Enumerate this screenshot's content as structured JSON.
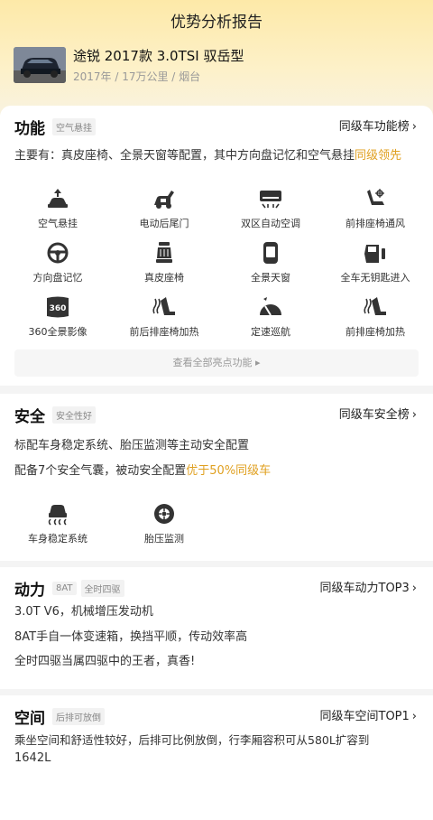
{
  "header": {
    "title": "优势分析报告",
    "car_name": "途锐 2017款 3.0TSI 驭岳型",
    "car_meta": "2017年 / 17万公里 / 烟台"
  },
  "function": {
    "title": "功能",
    "tag": "空气悬挂",
    "rank": "同级车功能榜",
    "desc_main": "主要有：真皮座椅、全景天窗等配置，其中方向盘记忆和空气悬挂",
    "desc_hl": "同级领先",
    "features": [
      {
        "label": "空气悬挂",
        "icon": "air-suspension-icon"
      },
      {
        "label": "电动后尾门",
        "icon": "power-tailgate-icon"
      },
      {
        "label": "双区自动空调",
        "icon": "dual-zone-ac-icon"
      },
      {
        "label": "前排座椅通风",
        "icon": "seat-ventilation-icon"
      },
      {
        "label": "方向盘记忆",
        "icon": "steering-wheel-icon"
      },
      {
        "label": "真皮座椅",
        "icon": "leather-seat-icon"
      },
      {
        "label": "全景天窗",
        "icon": "panoramic-sunroof-icon"
      },
      {
        "label": "全车无钥匙进入",
        "icon": "keyless-entry-icon"
      },
      {
        "label": "360全景影像",
        "icon": "camera-360-icon"
      },
      {
        "label": "前后排座椅加热",
        "icon": "seat-heating-icon"
      },
      {
        "label": "定速巡航",
        "icon": "cruise-control-icon"
      },
      {
        "label": "前排座椅加热",
        "icon": "front-seat-heating-icon"
      }
    ],
    "more": "查看全部亮点功能 ▸"
  },
  "safety": {
    "title": "安全",
    "tag": "安全性好",
    "rank": "同级车安全榜",
    "line1": "标配车身稳定系统、胎压监测等主动安全配置",
    "line2_main": "配备7个安全气囊，被动安全配置",
    "line2_hl": "优于50%同级车",
    "features": [
      {
        "label": "车身稳定系统",
        "icon": "stability-control-icon"
      },
      {
        "label": "胎压监测",
        "icon": "tire-pressure-icon"
      }
    ]
  },
  "power": {
    "title": "动力",
    "tags": [
      "8AT",
      "全时四驱"
    ],
    "rank": "同级车动力TOP3",
    "lines": [
      "3.0T V6，机械增压发动机",
      "8AT手自一体变速箱，换挡平顺，传动效率高",
      "全时四驱当属四驱中的王者，真香!"
    ]
  },
  "space": {
    "title": "空间",
    "tag": "后排可放倒",
    "rank": "同级车空间TOP1",
    "line1": "乘坐空间和舒适性较好，后排可比例放倒，行李厢容积可从580L扩容到",
    "line2": "1642L"
  },
  "colors": {
    "accent": "#e0a020",
    "hero_top": "#fde9a8"
  }
}
